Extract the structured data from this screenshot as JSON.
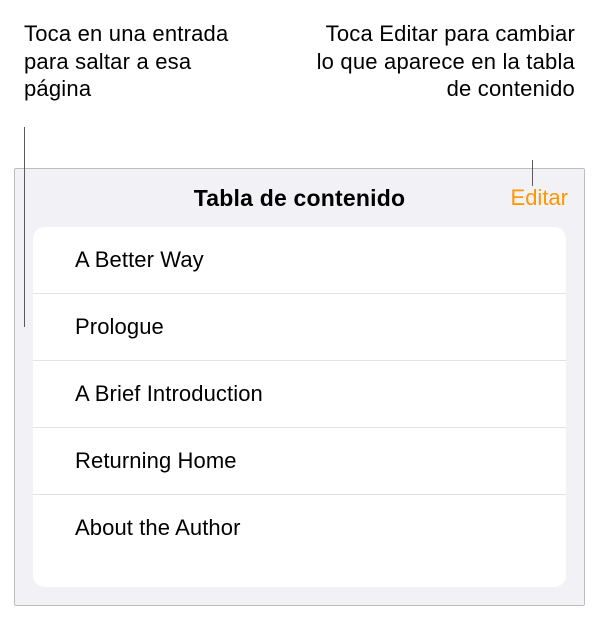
{
  "callouts": {
    "left": "Toca en una entrada para saltar a esa página",
    "right": "Toca Editar para cambiar lo que aparece en la tabla de contenido"
  },
  "panel": {
    "title": "Tabla de contenido",
    "edit_label": "Editar"
  },
  "toc": {
    "entries": [
      {
        "label": "A Better Way"
      },
      {
        "label": "Prologue"
      },
      {
        "label": "A Brief Introduction"
      },
      {
        "label": "Returning Home"
      },
      {
        "label": "About the Author"
      }
    ]
  },
  "colors": {
    "accent": "#ff9500",
    "panel_bg": "#f2f2f6",
    "divider": "#e3e3e6",
    "panel_border": "#bdbdbd"
  }
}
